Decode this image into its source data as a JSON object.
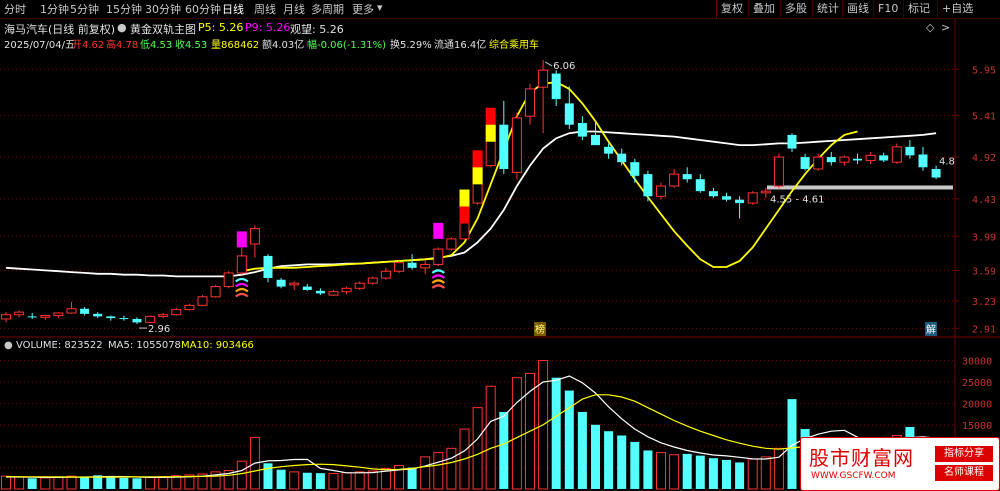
{
  "topbar": {
    "periods": [
      "分时",
      "1分钟",
      "5分钟",
      "15分钟",
      "30分钟",
      "60分钟",
      "日线",
      "周线",
      "月线",
      "多周期",
      "更多"
    ],
    "active_period": "日线",
    "buttons": [
      "复权",
      "叠加",
      "多股",
      "统计",
      "画线",
      "F10",
      "标记",
      "+自选"
    ],
    "icons": [
      "diamond-icon",
      "arrow-right-icon"
    ]
  },
  "header": {
    "stock_name": "海马汽车(日线 前复权)",
    "indicator_name": "黄金双轨主图",
    "p5": "P5: 5.26",
    "p9": "P9: 5.26",
    "watch": "观望: 5.26",
    "date": "2025/07/04/五",
    "open": "开4.62",
    "high": "高4.78",
    "low": "低4.53",
    "close": "收4.53",
    "volume": "量868462",
    "amount": "额4.03亿",
    "change": "幅-0.06(-1.31%)",
    "turnover": "换5.29%",
    "float_cap": "流通16.4亿",
    "tag": "综合乘用车"
  },
  "volume_header": {
    "volume": "VOLUME: 823522",
    "ma5": "MA5: 1055078",
    "ma10": "MA10: 903466"
  },
  "annotations": {
    "high_label": "6.06",
    "low_label": "2.96",
    "range_label": "4.55 - 4.61",
    "last_label": "4.8",
    "bang_marker": "榜",
    "jie_marker": "解"
  },
  "watermark": {
    "title": "股市财富网",
    "url": "WWW.GSCFW.COM",
    "tag1": "指标分享",
    "tag2": "名师课程"
  },
  "colors": {
    "up": "#ff3232",
    "down": "#54ffff",
    "ma_white": "#ffffff",
    "ma_yellow": "#ffff00",
    "grid": "#7a0000",
    "axis_text": "#c83232",
    "signal_magenta": "#ff00ff"
  },
  "chart_data": [
    {
      "type": "candlestick",
      "title": "黄金双轨主图",
      "y_ticks": [
        5.95,
        5.41,
        4.92,
        4.43,
        3.99,
        3.59,
        3.23,
        2.91
      ],
      "ylim": [
        2.82,
        6.2
      ],
      "candles": [
        {
          "o": 3.02,
          "h": 3.1,
          "l": 2.98,
          "c": 3.07
        },
        {
          "o": 3.07,
          "h": 3.12,
          "l": 3.04,
          "c": 3.1
        },
        {
          "o": 3.05,
          "h": 3.09,
          "l": 3.02,
          "c": 3.04
        },
        {
          "o": 3.04,
          "h": 3.07,
          "l": 3.01,
          "c": 3.06
        },
        {
          "o": 3.06,
          "h": 3.1,
          "l": 3.03,
          "c": 3.09
        },
        {
          "o": 3.09,
          "h": 3.22,
          "l": 3.08,
          "c": 3.14
        },
        {
          "o": 3.14,
          "h": 3.16,
          "l": 3.06,
          "c": 3.08
        },
        {
          "o": 3.08,
          "h": 3.1,
          "l": 3.03,
          "c": 3.05
        },
        {
          "o": 3.05,
          "h": 3.06,
          "l": 3.0,
          "c": 3.03
        },
        {
          "o": 3.03,
          "h": 3.06,
          "l": 3.0,
          "c": 3.02
        },
        {
          "o": 3.02,
          "h": 3.04,
          "l": 2.96,
          "c": 2.98
        },
        {
          "o": 2.98,
          "h": 3.06,
          "l": 2.97,
          "c": 3.05
        },
        {
          "o": 3.05,
          "h": 3.09,
          "l": 3.03,
          "c": 3.07
        },
        {
          "o": 3.07,
          "h": 3.15,
          "l": 3.06,
          "c": 3.13
        },
        {
          "o": 3.13,
          "h": 3.2,
          "l": 3.12,
          "c": 3.18
        },
        {
          "o": 3.18,
          "h": 3.3,
          "l": 3.17,
          "c": 3.28
        },
        {
          "o": 3.28,
          "h": 3.42,
          "l": 3.27,
          "c": 3.4
        },
        {
          "o": 3.4,
          "h": 3.58,
          "l": 3.38,
          "c": 3.56
        },
        {
          "o": 3.56,
          "h": 4.02,
          "l": 3.54,
          "c": 3.76
        },
        {
          "o": 3.9,
          "h": 4.12,
          "l": 3.74,
          "c": 4.08
        },
        {
          "o": 3.76,
          "h": 3.78,
          "l": 3.45,
          "c": 3.5
        },
        {
          "o": 3.48,
          "h": 3.5,
          "l": 3.38,
          "c": 3.4
        },
        {
          "o": 3.42,
          "h": 3.46,
          "l": 3.36,
          "c": 3.44
        },
        {
          "o": 3.4,
          "h": 3.43,
          "l": 3.35,
          "c": 3.36
        },
        {
          "o": 3.35,
          "h": 3.38,
          "l": 3.3,
          "c": 3.32
        },
        {
          "o": 3.3,
          "h": 3.36,
          "l": 3.29,
          "c": 3.34
        },
        {
          "o": 3.34,
          "h": 3.4,
          "l": 3.31,
          "c": 3.38
        },
        {
          "o": 3.38,
          "h": 3.46,
          "l": 3.36,
          "c": 3.44
        },
        {
          "o": 3.44,
          "h": 3.52,
          "l": 3.42,
          "c": 3.5
        },
        {
          "o": 3.5,
          "h": 3.62,
          "l": 3.48,
          "c": 3.58
        },
        {
          "o": 3.58,
          "h": 3.7,
          "l": 3.56,
          "c": 3.68
        },
        {
          "o": 3.68,
          "h": 3.78,
          "l": 3.6,
          "c": 3.62
        },
        {
          "o": 3.62,
          "h": 3.7,
          "l": 3.55,
          "c": 3.66
        },
        {
          "o": 3.66,
          "h": 3.86,
          "l": 3.64,
          "c": 3.84
        },
        {
          "o": 3.84,
          "h": 3.98,
          "l": 3.82,
          "c": 3.96
        },
        {
          "o": 3.96,
          "h": 4.4,
          "l": 3.95,
          "c": 4.38
        },
        {
          "o": 4.38,
          "h": 4.84,
          "l": 4.36,
          "c": 4.82
        },
        {
          "o": 4.82,
          "h": 5.3,
          "l": 4.8,
          "c": 5.28
        },
        {
          "o": 5.3,
          "h": 5.58,
          "l": 4.72,
          "c": 4.78
        },
        {
          "o": 4.74,
          "h": 5.44,
          "l": 4.66,
          "c": 5.38
        },
        {
          "o": 5.4,
          "h": 5.78,
          "l": 5.3,
          "c": 5.72
        },
        {
          "o": 5.74,
          "h": 6.06,
          "l": 5.2,
          "c": 5.94
        },
        {
          "o": 5.9,
          "h": 5.94,
          "l": 5.52,
          "c": 5.6
        },
        {
          "o": 5.55,
          "h": 5.75,
          "l": 5.25,
          "c": 5.3
        },
        {
          "o": 5.32,
          "h": 5.4,
          "l": 5.12,
          "c": 5.16
        },
        {
          "o": 5.18,
          "h": 5.34,
          "l": 5.06,
          "c": 5.06
        },
        {
          "o": 5.04,
          "h": 5.08,
          "l": 4.9,
          "c": 4.96
        },
        {
          "o": 4.96,
          "h": 5.02,
          "l": 4.82,
          "c": 4.86
        },
        {
          "o": 4.86,
          "h": 4.9,
          "l": 4.62,
          "c": 4.7
        },
        {
          "o": 4.72,
          "h": 4.76,
          "l": 4.4,
          "c": 4.46
        },
        {
          "o": 4.46,
          "h": 4.62,
          "l": 4.42,
          "c": 4.58
        },
        {
          "o": 4.58,
          "h": 4.78,
          "l": 4.56,
          "c": 4.72
        },
        {
          "o": 4.72,
          "h": 4.8,
          "l": 4.62,
          "c": 4.66
        },
        {
          "o": 4.66,
          "h": 4.72,
          "l": 4.5,
          "c": 4.52
        },
        {
          "o": 4.52,
          "h": 4.56,
          "l": 4.44,
          "c": 4.46
        },
        {
          "o": 4.46,
          "h": 4.5,
          "l": 4.4,
          "c": 4.42
        },
        {
          "o": 4.42,
          "h": 4.46,
          "l": 4.2,
          "c": 4.38
        },
        {
          "o": 4.38,
          "h": 4.52,
          "l": 4.36,
          "c": 4.5
        },
        {
          "o": 4.5,
          "h": 4.56,
          "l": 4.44,
          "c": 4.52
        },
        {
          "o": 4.58,
          "h": 4.96,
          "l": 4.55,
          "c": 4.92
        },
        {
          "o": 5.18,
          "h": 5.2,
          "l": 4.98,
          "c": 5.02
        },
        {
          "o": 4.92,
          "h": 4.96,
          "l": 4.76,
          "c": 4.78
        },
        {
          "o": 4.78,
          "h": 4.96,
          "l": 4.76,
          "c": 4.92
        },
        {
          "o": 4.92,
          "h": 4.98,
          "l": 4.82,
          "c": 4.86
        },
        {
          "o": 4.86,
          "h": 4.94,
          "l": 4.82,
          "c": 4.92
        },
        {
          "o": 4.9,
          "h": 4.96,
          "l": 4.84,
          "c": 4.88
        },
        {
          "o": 4.88,
          "h": 4.98,
          "l": 4.84,
          "c": 4.94
        },
        {
          "o": 4.94,
          "h": 4.97,
          "l": 4.86,
          "c": 4.88
        },
        {
          "o": 4.86,
          "h": 5.08,
          "l": 4.84,
          "c": 5.04
        },
        {
          "o": 5.04,
          "h": 5.12,
          "l": 4.9,
          "c": 4.94
        },
        {
          "o": 4.95,
          "h": 5.04,
          "l": 4.76,
          "c": 4.8
        },
        {
          "o": 4.78,
          "h": 4.82,
          "l": 4.66,
          "c": 4.68
        }
      ],
      "ma_white": [
        3.62,
        3.61,
        3.6,
        3.59,
        3.58,
        3.57,
        3.56,
        3.55,
        3.55,
        3.54,
        3.54,
        3.53,
        3.53,
        3.52,
        3.52,
        3.52,
        3.52,
        3.52,
        3.54,
        3.57,
        3.61,
        3.64,
        3.65,
        3.66,
        3.66,
        3.66,
        3.67,
        3.67,
        3.68,
        3.69,
        3.7,
        3.71,
        3.72,
        3.74,
        3.76,
        3.8,
        3.92,
        4.08,
        4.3,
        4.58,
        4.82,
        5.02,
        5.14,
        5.2,
        5.22,
        5.22,
        5.21,
        5.2,
        5.19,
        5.18,
        5.17,
        5.16,
        5.14,
        5.12,
        5.1,
        5.08,
        5.06,
        5.06,
        5.07,
        5.08,
        5.08,
        5.09,
        5.1,
        5.11,
        5.12,
        5.13,
        5.14,
        5.15,
        5.16,
        5.17,
        5.18,
        5.2
      ],
      "ma_yellow": [
        null,
        null,
        null,
        null,
        null,
        null,
        null,
        null,
        null,
        null,
        null,
        null,
        null,
        null,
        null,
        null,
        null,
        null,
        3.58,
        3.61,
        3.62,
        3.62,
        3.62,
        3.63,
        3.64,
        3.65,
        3.66,
        3.67,
        3.68,
        3.69,
        3.7,
        3.71,
        3.72,
        3.73,
        3.77,
        3.92,
        4.2,
        4.6,
        5.0,
        5.4,
        5.68,
        5.78,
        5.8,
        5.72,
        5.55,
        5.34,
        5.1,
        4.88,
        4.66,
        4.45,
        4.25,
        4.05,
        3.88,
        3.72,
        3.63,
        3.63,
        3.7,
        3.86,
        4.08,
        4.3,
        4.52,
        4.72,
        4.9,
        5.06,
        5.18,
        5.22,
        null,
        null,
        null,
        null,
        null,
        null
      ],
      "signals": [
        {
          "index": 18,
          "type": "magenta-block",
          "value": 3.86
        },
        {
          "index": 18,
          "type": "wifi-marker",
          "value": 3.46
        },
        {
          "index": 33,
          "type": "magenta-block",
          "value": 3.96
        },
        {
          "index": 33,
          "type": "wifi-marker",
          "value": 3.56
        },
        {
          "index": 35,
          "type": "bar-pair",
          "upper": "yellow",
          "lower": "red",
          "value": 4.14
        },
        {
          "index": 36,
          "type": "bar-pair",
          "upper": "red",
          "lower": "yellow",
          "value": 4.6
        },
        {
          "index": 37,
          "type": "bar-pair",
          "upper": "red",
          "lower": "yellow",
          "value": 5.1
        }
      ],
      "support_zone": [
        4.55,
        4.61
      ]
    },
    {
      "type": "bar",
      "title": "VOLUME",
      "y_ticks": [
        30000,
        25000,
        20000,
        15000,
        10000,
        5000
      ],
      "ylim": [
        0,
        32000
      ],
      "series": [
        {
          "name": "VOLUME",
          "values": [
            3000,
            2800,
            2500,
            2600,
            2700,
            3000,
            2900,
            3200,
            2800,
            2600,
            2500,
            2700,
            2900,
            3100,
            3300,
            3500,
            4000,
            4300,
            6500,
            12000,
            6000,
            4500,
            4000,
            3800,
            3700,
            3600,
            3800,
            4000,
            4200,
            4800,
            5500,
            5000,
            7500,
            8500,
            9500,
            14000,
            19000,
            24000,
            18000,
            26000,
            27000,
            30000,
            26000,
            23000,
            18000,
            15000,
            13500,
            12500,
            11000,
            9000,
            8500,
            8000,
            8200,
            7800,
            7200,
            6800,
            6200,
            7000,
            7500,
            9500,
            21000,
            14000,
            12000,
            11000,
            10500,
            11000,
            11500,
            10500,
            12500,
            14500,
            12000,
            10000
          ]
        },
        {
          "name": "MA5",
          "values": [
            2800,
            2800,
            2750,
            2700,
            2720,
            2760,
            2800,
            2860,
            2920,
            2900,
            2800,
            2700,
            2700,
            2760,
            2860,
            3000,
            3300,
            3620,
            4320,
            6060,
            6560,
            6660,
            6880,
            6920,
            4800,
            4320,
            3780,
            3780,
            3820,
            4180,
            4460,
            4700,
            5400,
            6260,
            7200,
            8900,
            11700,
            15800,
            17000,
            20200,
            22800,
            25000,
            25400,
            26400,
            24800,
            22400,
            19200,
            16400,
            14000,
            12200,
            10800,
            9800,
            9000,
            8400,
            7940,
            7720,
            7400,
            7020,
            7000,
            7420,
            10200,
            11800,
            12800,
            13500,
            13700,
            12100,
            11000,
            10800,
            11400,
            12000,
            12200,
            11900
          ]
        },
        {
          "name": "MA10",
          "values": [
            2900,
            2880,
            2860,
            2840,
            2820,
            2800,
            2780,
            2780,
            2790,
            2800,
            2820,
            2840,
            2860,
            2880,
            2920,
            2950,
            3000,
            3200,
            3600,
            4200,
            4800,
            5200,
            5500,
            5700,
            5800,
            5700,
            5400,
            5100,
            4700,
            4500,
            4600,
            4800,
            5200,
            5600,
            6200,
            7000,
            8100,
            9500,
            10500,
            12000,
            13500,
            15000,
            17000,
            19000,
            21000,
            22000,
            22000,
            21500,
            20500,
            19000,
            17500,
            16000,
            14700,
            13500,
            12500,
            11500,
            10700,
            10000,
            9500,
            9300,
            9600,
            9900,
            10100,
            10300,
            10500,
            10800,
            11100,
            11300,
            11500,
            11700,
            11900,
            11900
          ]
        }
      ]
    }
  ]
}
